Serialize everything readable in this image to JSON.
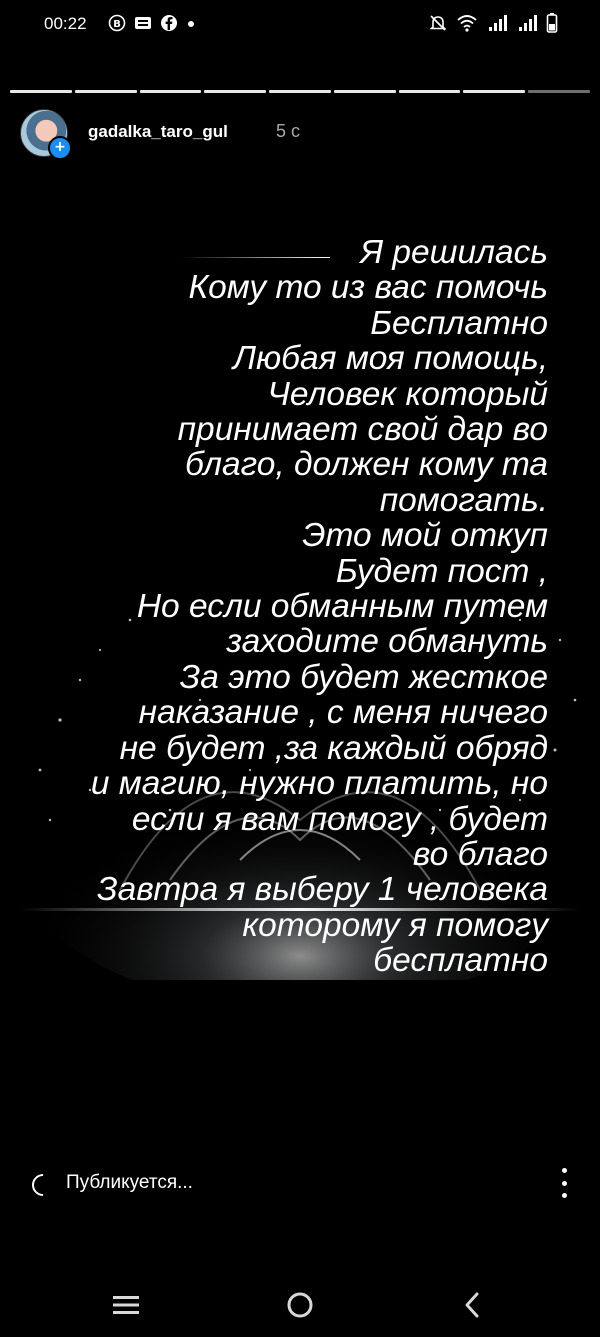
{
  "status_bar": {
    "time": "00:22",
    "left_icons": [
      "b-circle-icon",
      "mail-icon",
      "facebook-icon",
      "dot-icon"
    ],
    "right_icons": [
      "mute-icon",
      "wifi-icon",
      "signal-icon",
      "signal-icon-2",
      "battery-icon"
    ]
  },
  "story": {
    "segments_total": 9,
    "current_segment": 9,
    "username": "gadalka_taro_gul",
    "age": "5 с",
    "text_lines": [
      "Я решилась",
      "Кому то из вас помочь",
      "Бесплатно",
      "Любая моя помощь,",
      "Человек который",
      "принимает свой дар во",
      "благо, должен кому та",
      "помогать.",
      "Это мой откуп",
      "Будет пост ,",
      "Но если обманным путем",
      "заходите обмануть",
      "За это будет жесткое",
      "наказание , с меня ничего",
      "не будет ,за каждый обряд",
      "и магию, нужно платить, но",
      "если я вам помогу , будет",
      "во благо",
      "Завтра я выберу 1 человека",
      "которому я  помогу",
      "бесплатно"
    ]
  },
  "footer": {
    "status": "Публикуется..."
  },
  "colors": {
    "background": "#000000",
    "accent_blue": "#1b8df1",
    "text": "#ffffff",
    "muted": "#aaaaaa"
  }
}
